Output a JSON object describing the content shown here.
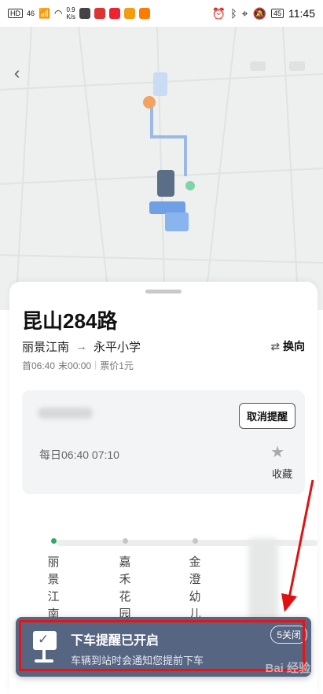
{
  "status_bar": {
    "signal": "46",
    "speed": "0.9",
    "speed_unit": "K/s",
    "battery": "45",
    "time": "11:45"
  },
  "map": {
    "back_icon": "back-arrow-icon"
  },
  "sheet": {
    "line_name": "昆山284路",
    "from": "丽景江南",
    "to": "永平小学",
    "arrow": "→",
    "swap_label": "换向",
    "first_bus": "首06:40",
    "last_bus": "末00:00",
    "fare": "票价1元"
  },
  "reminder_card": {
    "cancel_label": "取消提醒",
    "times": "每日06:40 07:10",
    "favorite_label": "收藏"
  },
  "stops": [
    "丽景江南",
    "嘉禾花园",
    "金澄幼儿"
  ],
  "toast": {
    "title": "下车提醒已开启",
    "subtitle": "车辆到站时会通知您提前下车",
    "close_label": "5关闭"
  },
  "watermark": "Bai 经验",
  "colors": {
    "accent_green": "#2fa86d",
    "toast_bg": "#566582",
    "annotation_red": "#e11111"
  }
}
